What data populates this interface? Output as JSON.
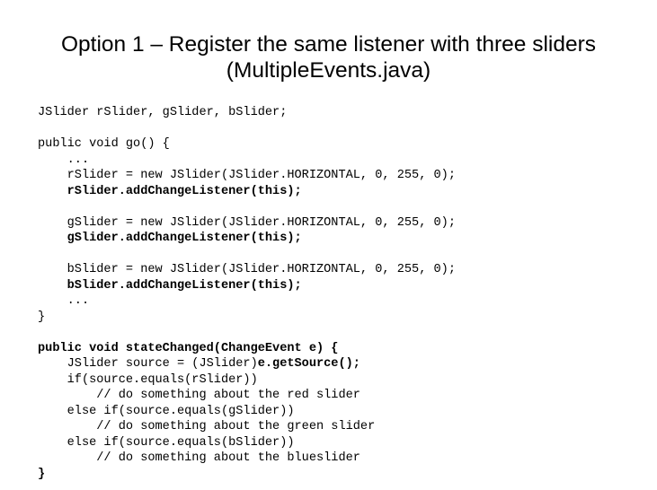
{
  "slide": {
    "title_line1": "Option 1 – Register the same listener with three sliders",
    "title_line2": "(MultipleEvents.java)"
  },
  "code": {
    "l01": "JSlider rSlider, gSlider, bSlider;",
    "l02": "",
    "l03": "public void go() {",
    "l04": "    ...",
    "l05": "    rSlider = new JSlider(JSlider.HORIZONTAL, 0, 255, 0);",
    "l06": "    rSlider.addChangeListener(this);",
    "l07": "",
    "l08": "    gSlider = new JSlider(JSlider.HORIZONTAL, 0, 255, 0);",
    "l09": "    gSlider.addChangeListener(this);",
    "l10": "",
    "l11": "    bSlider = new JSlider(JSlider.HORIZONTAL, 0, 255, 0);",
    "l12": "    bSlider.addChangeListener(this);",
    "l13": "    ...",
    "l14": "}",
    "l15": "",
    "l16": "public void stateChanged(ChangeEvent e) {",
    "l17a": "    JSlider source = (JSlider)",
    "l17b": "e.getSource();",
    "l18": "    if(source.equals(rSlider))",
    "l19": "        // do something about the red slider",
    "l20": "    else if(source.equals(gSlider))",
    "l21": "        // do something about the green slider",
    "l22": "    else if(source.equals(bSlider))",
    "l23": "        // do something about the blueslider",
    "l24": "}"
  }
}
